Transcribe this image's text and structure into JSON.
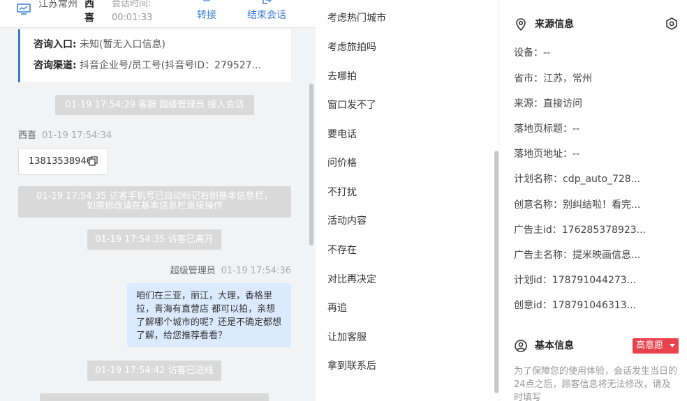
{
  "chat": {
    "header": {
      "city": "江苏常州",
      "visitor_name": "西喜",
      "session_label": "会话时间:",
      "session_time": "00:01:33",
      "transfer_label": "转接",
      "end_label": "结束会话"
    },
    "info_card": {
      "entry_label": "咨询入口:",
      "entry_value": "未知(暂无入口信息)",
      "channel_label": "咨询渠道:",
      "channel_value": "抖音企业号/员工号(抖音号ID：279527..."
    },
    "system_messages": {
      "m1": "01-19 17:54:29 客服 超级管理员 接入会话",
      "m2_line1": "01-19 17:54:35 访客手机号已自动标记右侧基本信息栏，",
      "m2_line2": "如需修改请在基本信息栏直接操作",
      "m3": "01-19 17:54:35 访客已离开",
      "m4": "01-19 17:54:42 访客已进线"
    },
    "visitor_msg": {
      "sender": "西喜",
      "time": "01-19 17:54:34",
      "phone": "13813538946"
    },
    "agent_msg": {
      "sender": "超级管理员",
      "time": "01-19 17:54:36",
      "text": "咱们在三亚，丽江，大理，香格里拉，青海有直营店 都可以拍，亲想了解哪个城市的呢？还是不确定都想了解，给您推荐看看？"
    }
  },
  "quick_replies": [
    "考虑热门城市",
    "考虑旅拍吗",
    "去哪拍",
    "窗口发不了",
    "要电话",
    "问价格",
    "不打扰",
    "活动内容",
    "不存在",
    "对比再决定",
    "再追",
    "让加客服",
    "拿到联系后"
  ],
  "source": {
    "title": "来源信息",
    "device": "设备：--",
    "province": "省市：江苏，常州",
    "origin": "来源：直接访问",
    "landing_title": "落地页标题：--",
    "landing_url": "落地页地址：--",
    "plan_name": "计划名称：cdp_auto_728...",
    "creative_name": "创意名称：别纠结啦！看完...",
    "advertiser_id": "广告主id：176285378923...",
    "advertiser_name": "广告主名称：提米映画信息...",
    "plan_id": "计划id：178791044273...",
    "creative_id": "创意id：178791046313..."
  },
  "basic": {
    "title": "基本信息",
    "intent_badge": "高意愿",
    "notice": "为了保障您的使用体验，会话发生当日的24点之后，顾客信息将无法修改，请及时填写"
  },
  "colors": {
    "accent": "#3a7bd5",
    "agent_bubble": "#dceaff",
    "system_msg": "#d9d9d9",
    "chat_bg": "#f2f3f5",
    "intent_badge": "#e8434d"
  },
  "icons": {
    "header_monitor": "monitor-icon",
    "transfer": "transfer-icon",
    "end_session": "exit-icon",
    "copy": "copy-icon",
    "source": "location-pin-icon",
    "settings": "hexagon-settings-icon",
    "basic": "user-circle-icon"
  }
}
